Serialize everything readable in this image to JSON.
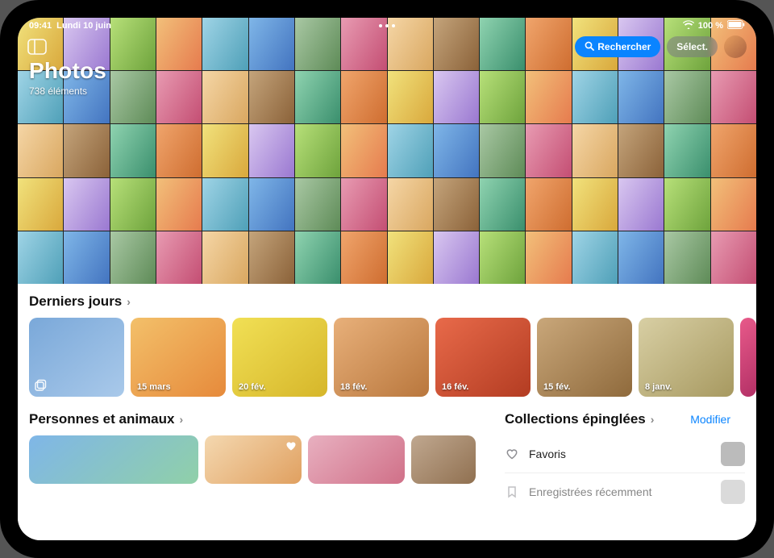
{
  "status": {
    "time": "09:41",
    "date": "Lundi 10 juin",
    "battery": "100 %"
  },
  "toolbar": {
    "search_label": "Rechercher",
    "select_label": "Sélect."
  },
  "header": {
    "title": "Photos",
    "subtitle": "738 éléments"
  },
  "sections": {
    "recent_days": {
      "title": "Derniers jours",
      "items": [
        {
          "label": ""
        },
        {
          "label": "15 mars"
        },
        {
          "label": "20 fév."
        },
        {
          "label": "18 fév."
        },
        {
          "label": "16 fév."
        },
        {
          "label": "15 fév."
        },
        {
          "label": "8 janv."
        }
      ]
    },
    "people": {
      "title": "Personnes et animaux"
    },
    "pinned": {
      "title": "Collections épinglées",
      "edit_label": "Modifier",
      "rows": [
        {
          "label": "Favoris"
        },
        {
          "label": "Enregistrées récemment"
        }
      ]
    }
  }
}
